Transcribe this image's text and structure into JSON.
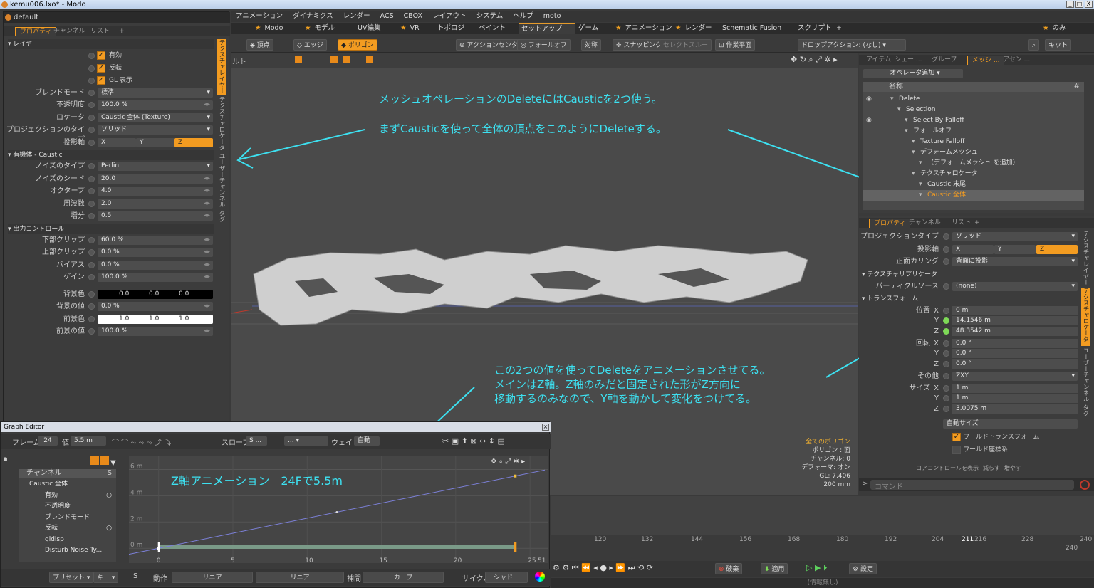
{
  "window": {
    "title": "kemu006.lxo* - Modo",
    "controls": [
      "_",
      "□",
      "X"
    ]
  },
  "menu": [
    "アニメーション",
    "ダイナミクス",
    "レンダー",
    "ACS",
    "CBOX",
    "レイアウト",
    "システム",
    "ヘルプ",
    "moto"
  ],
  "layout_tabs": [
    {
      "label": "Modo",
      "star": true
    },
    {
      "label": "モデル",
      "star": true
    },
    {
      "label": "UV編集",
      "star": false
    },
    {
      "label": "VR",
      "star": true
    },
    {
      "label": "トポロジ",
      "star": false
    },
    {
      "label": "ペイント",
      "star": false
    },
    {
      "label": "セットアップ",
      "star": false,
      "active": true
    },
    {
      "label": "ゲーム",
      "star": false
    },
    {
      "label": "アニメーション",
      "star": true
    },
    {
      "label": "レンダー",
      "star": true
    },
    {
      "label": "Schematic Fusion",
      "star": false
    },
    {
      "label": "スクリプト",
      "star": false
    },
    {
      "label": "+",
      "star": false
    }
  ],
  "layout_right": {
    "label": "のみ",
    "star": true
  },
  "toolbar": {
    "vertex": "頂点",
    "edge": "エッジ",
    "polygon": "ポリゴン",
    "action_center": "アクションセンター",
    "falloff": "フォールオフ",
    "symmetry": "対称",
    "snapping": "スナッピング",
    "select_through": "セレクトスルー",
    "workplane": "作業平面",
    "drop_action": "ドロップアクション: (なし)",
    "kit": "キット"
  },
  "left_panel": {
    "title": "default",
    "tabs": [
      "プロパティ",
      "チャンネル",
      "リスト",
      "+"
    ],
    "layer_section": "レイヤー",
    "checks": [
      {
        "label": "有効",
        "checked": true
      },
      {
        "label": "反転",
        "checked": true
      },
      {
        "label": "GL 表示",
        "checked": true
      }
    ],
    "fields": [
      {
        "label": "ブレンドモード",
        "value": "標準",
        "dropdown": true
      },
      {
        "label": "不透明度",
        "value": "100.0 %"
      },
      {
        "label": "ロケータ",
        "value": "Caustic 全体 (Texture)",
        "dropdown": true
      },
      {
        "label": "プロジェクションのタイプ",
        "value": "ソリッド",
        "dropdown": true
      }
    ],
    "axis": {
      "label": "投影軸",
      "values": [
        "X",
        "Y",
        "Z"
      ],
      "selected": "Z"
    },
    "noise_section": "有機体 - Caustic",
    "noise_fields": [
      {
        "label": "ノイズのタイプ",
        "value": "Perlin",
        "dropdown": true
      },
      {
        "label": "ノイズのシード",
        "value": "20.0"
      },
      {
        "label": "オクターブ",
        "value": "4.0"
      },
      {
        "label": "周波数",
        "value": "2.0"
      },
      {
        "label": "増分",
        "value": "0.5"
      }
    ],
    "output_section": "出力コントロール",
    "output_fields": [
      {
        "label": "下部クリップ",
        "value": "60.0 %"
      },
      {
        "label": "上部クリップ",
        "value": "0.0 %"
      },
      {
        "label": "バイアス",
        "value": "0.0 %"
      },
      {
        "label": "ゲイン",
        "value": "100.0 %"
      }
    ],
    "bg_color": {
      "label": "背景色",
      "values": [
        "0.0",
        "0.0",
        "0.0"
      ]
    },
    "bg_value": {
      "label": "背景の値",
      "value": "0.0 %"
    },
    "fg_color": {
      "label": "前景色",
      "values": [
        "1.0",
        "1.0",
        "1.0"
      ]
    },
    "fg_value": {
      "label": "前景の値",
      "value": "100.0 %"
    },
    "side_tabs": [
      "テクスチャレイヤー",
      "テクスチャロケータ",
      "ユーザーチャンネル",
      "タグ"
    ]
  },
  "viewport": {
    "label": "ルト",
    "stats": [
      "全てのポリゴン",
      "ポリゴン : 面",
      "チャンネル: 0",
      "デフォーマ: オン",
      "GL: 7,406",
      "200 mm"
    ]
  },
  "annotations": {
    "a1": "メッシュオペレーションのDeleteにはCausticを2つ使う。",
    "a2": "まずCausticを使って全体の頂点をこのようにDeleteする。",
    "a3": [
      "この2つの値を使ってDeleteをアニメーションさせてる。",
      "メインはZ軸。Z軸のみだと固定された形がZ方向に",
      "移動するのみなので、Y軸を動かして変化をつけてる。"
    ],
    "a4": "Z軸アニメーション　24Fで5.5m"
  },
  "item_panel": {
    "tabs": [
      "アイテム",
      "シェー ...",
      "グループ",
      "メッシ ...",
      "アセン ..."
    ],
    "add_op": "オペレータ追加",
    "col_name": "名称",
    "items": [
      {
        "label": "Delete",
        "depth": 1
      },
      {
        "label": "Selection",
        "depth": 2
      },
      {
        "label": "Select By Falloff",
        "depth": 3
      },
      {
        "label": "フォールオフ",
        "depth": 3
      },
      {
        "label": "Texture Falloff",
        "depth": 4
      },
      {
        "label": "デフォームメッシュ",
        "depth": 4
      },
      {
        "label": "（デフォームメッシュ を追加）",
        "depth": 5
      },
      {
        "label": "テクスチャロケータ",
        "depth": 4
      },
      {
        "label": "Caustic 末尾",
        "depth": 5
      },
      {
        "label": "Caustic 全体",
        "depth": 5,
        "selected": true
      }
    ]
  },
  "right_props": {
    "tabs": [
      "プロパティ",
      "チャンネル",
      "リスト",
      "+"
    ],
    "proj_type": {
      "label": "プロジェクションタイプ",
      "value": "ソリッド"
    },
    "axis": {
      "label": "投影軸",
      "values": [
        "X",
        "Y",
        "Z"
      ],
      "selected": "Z"
    },
    "culling": {
      "label": "正面カリング",
      "value": "背面に投影"
    },
    "tex_replicator": "テクスチャリプリケータ",
    "particle_source": {
      "label": "パーティクルソース",
      "value": "(none)"
    },
    "transform": "トランスフォーム",
    "position": {
      "label": "位置",
      "axes": [
        "X",
        "Y",
        "Z"
      ],
      "values": [
        "0 m",
        "14.1546 m",
        "48.3542 m"
      ]
    },
    "rotation": {
      "label": "回転",
      "axes": [
        "X",
        "Y",
        "Z"
      ],
      "values": [
        "0.0 °",
        "0.0 °",
        "0.0 °"
      ]
    },
    "other": {
      "label": "その他",
      "value": "ZXY"
    },
    "size": {
      "label": "サイズ",
      "axes": [
        "X",
        "Y",
        "Z"
      ],
      "values": [
        "1 m",
        "1 m",
        "3.0075 m"
      ]
    },
    "autosize": "自動サイズ",
    "world_transform": "ワールドトランスフォーム",
    "world_coord": "ワールド座標系",
    "footer": [
      "コアコントロールを表示",
      "減らす",
      "増やす"
    ],
    "side_tabs": [
      "テクスチャレイヤー",
      "テクスチャロケータ",
      "ユーザーチャンネル",
      "タグ"
    ],
    "command_placeholder": "コマンド"
  },
  "timeline": {
    "ticks": [
      "120",
      "132",
      "144",
      "156",
      "168",
      "180",
      "192",
      "204",
      "211",
      "216",
      "228",
      "240"
    ],
    "end": "240"
  },
  "transport": {
    "delete": "破棄",
    "apply": "適用",
    "settings": "設定",
    "info": "(情報無し)"
  },
  "graph_editor": {
    "title": "Graph Editor",
    "frame_label": "フレーム",
    "frame": "24",
    "value_label": "値",
    "value": "5.5 m",
    "slope_label": "スロープ",
    "slope_value": "S ...",
    "weight_label": "ウェイト",
    "weight_value": "自動",
    "channel_header": "チャンネル",
    "channel_s": "S",
    "channels": [
      "Caustic 全体",
      "有効",
      "不透明度",
      "ブレンドモード",
      "反転",
      "gldisp",
      "Disturb Noise Ty..."
    ],
    "y_ticks": [
      "6 m",
      "4 m",
      "2 m",
      "0 m"
    ],
    "x_ticks": [
      "0",
      "5",
      "10",
      "15",
      "20",
      "25"
    ],
    "x_end": "51",
    "footer": {
      "preset": "プリセット",
      "key": "キー",
      "key_s": "S",
      "action": "動作",
      "linear1": "リニア",
      "linear2": "リニア",
      "interp": "補間",
      "curve": "カーブ",
      "cycle": "サイクル",
      "shadow": "シャドー"
    }
  },
  "chart_data": {
    "type": "line",
    "series": [
      {
        "name": "",
        "x": [
          0,
          24
        ],
        "y": [
          0,
          5.5
        ]
      }
    ],
    "xlim": [
      -2,
      26
    ],
    "ylim": [
      -0.8,
      7
    ],
    "xlabel": "",
    "ylabel": "",
    "title": ""
  }
}
